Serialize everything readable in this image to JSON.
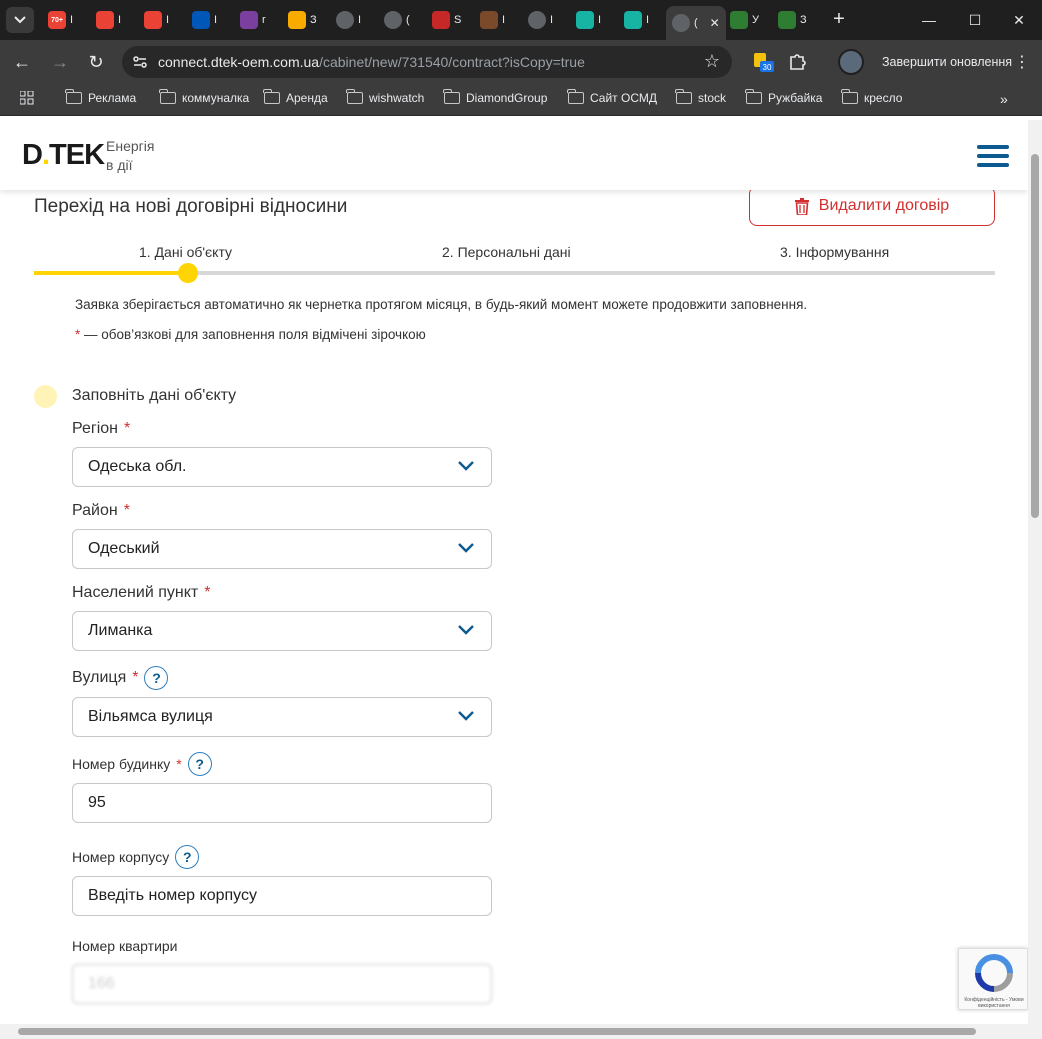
{
  "browser": {
    "tabs": [
      {
        "icon": "gmail-icon",
        "badge": "70+",
        "title": "I"
      },
      {
        "icon": "gmail-icon",
        "title": "I"
      },
      {
        "icon": "gmail-icon",
        "title": "I"
      },
      {
        "icon": "ukraine-flag-icon",
        "title": "I"
      },
      {
        "icon": "w-icon",
        "title": "r"
      },
      {
        "icon": "analytics-icon",
        "title": "З"
      },
      {
        "icon": "globe-icon",
        "title": "I"
      },
      {
        "icon": "settings-globe-icon",
        "title": "("
      },
      {
        "icon": "target-icon",
        "title": "S"
      },
      {
        "icon": "bean-icon",
        "title": "I"
      },
      {
        "icon": "globe-icon",
        "title": "I"
      },
      {
        "icon": "ol-icon",
        "title": "I"
      },
      {
        "icon": "ol-icon",
        "title": "I"
      },
      {
        "icon": "page-icon",
        "title": "(",
        "active": true
      },
      {
        "icon": "dtek-icon",
        "title": "У"
      },
      {
        "icon": "dtek-icon",
        "title": "З"
      }
    ],
    "url_host": "connect.dtek-oem.com.ua",
    "url_path": "/cabinet/new/731540/contract?isCopy=true",
    "extension_badge": "30",
    "update_button": "Завершити оновлення",
    "bookmarks": [
      "Реклама",
      "коммуналка",
      "Аренда",
      "wishwatch",
      "DiamondGroup",
      "Сайт ОСМД",
      "stock",
      "Ружбайка",
      "кресло"
    ]
  },
  "header": {
    "logo": "D.TEK",
    "tagline_line1": "Енергія",
    "tagline_line2": "в дії"
  },
  "page": {
    "title": "Перехід на нові договірні відносини",
    "delete_button": "Видалити договір",
    "steps": [
      "1. Дані об'єкту",
      "2. Персональні дані",
      "3. Інформування"
    ],
    "progress_fraction": 0.16,
    "note": "Заявка зберігається автоматично як чернетка протягом місяця, в будь-який момент можете продовжити заповнення.",
    "required_star": "*",
    "required_note": " — обов’язкові для заповнення поля відмічені зірочкою",
    "section_title": "Заповніть дані об'єкту"
  },
  "form": {
    "region": {
      "label": "Регіон",
      "value": "Одеська обл."
    },
    "district": {
      "label": "Район",
      "value": "Одеський"
    },
    "settlement": {
      "label": "Населений пункт",
      "value": "Лиманка"
    },
    "street": {
      "label": "Вулиця",
      "value": "Вільямса вулиця"
    },
    "house": {
      "label": "Номер будинку",
      "value": "95"
    },
    "building": {
      "label": "Номер корпусу",
      "placeholder": "Введіть номер корпусу"
    },
    "apartment": {
      "label": "Номер квартири",
      "value": "166"
    }
  },
  "recaptcha": {
    "text": "Конфіденційність - Умови використання"
  },
  "colors": {
    "accent": "#ffd400",
    "danger": "#d32f2f",
    "brand_blue": "#0c5a8f"
  }
}
